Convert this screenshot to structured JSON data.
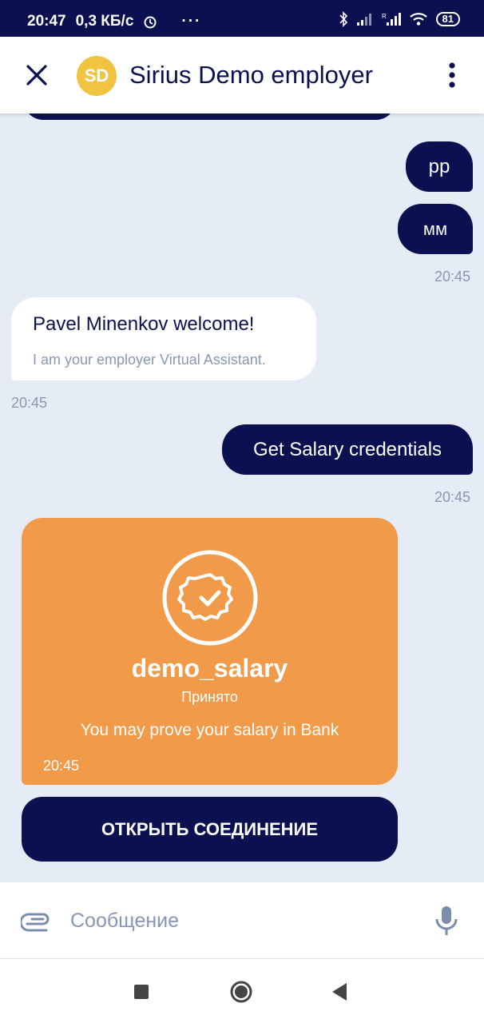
{
  "status_bar": {
    "time": "20:47",
    "speed": "0,3 КБ/с",
    "dots": "···",
    "battery": "81"
  },
  "header": {
    "avatar_initials": "SD",
    "title": "Sirius Demo employer"
  },
  "messages": {
    "out_1": "pp",
    "out_2": "мм",
    "out_2_time": "20:45",
    "in_title": "Pavel Minenkov welcome!",
    "in_subtitle": "I am your employer Virtual Assistant.",
    "in_time": "20:45",
    "out_3": "Get Salary credentials",
    "out_3_time": "20:45"
  },
  "credential": {
    "name": "demo_salary",
    "status": "Принято",
    "description": "You may prove your salary in Bank",
    "time": "20:45",
    "color": "#f09a4a"
  },
  "action_button": {
    "label": "ОТКРЫТЬ СОЕДИНЕНИЕ"
  },
  "composer": {
    "placeholder": "Сообщение"
  },
  "colors": {
    "primary": "#0b1150",
    "background": "#e6ecf5",
    "muted": "#8898b4",
    "avatar": "#f0c440"
  }
}
